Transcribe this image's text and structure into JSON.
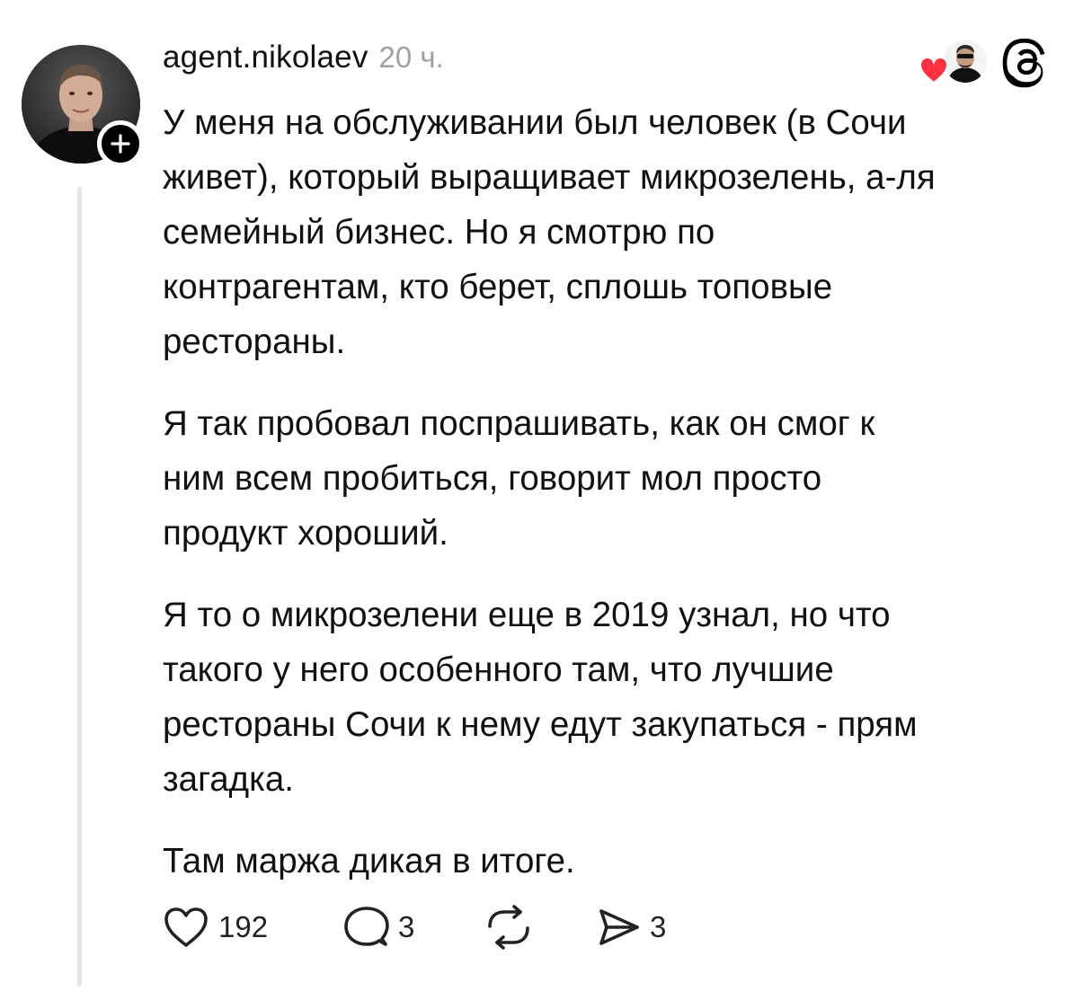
{
  "post": {
    "username": "agent.nikolaev",
    "timestamp": "20 ч.",
    "paragraphs": [
      "У меня на обслуживании был человек (в Сочи\nживет), который выращивает микрозелень, а-ля\nсемейный бизнес. Но я смотрю по\nконтрагентам, кто берет, сплошь топовые\nрестораны.",
      "Я так пробовал поспрашивать, как он смог к\nним всем пробиться, говорит мол просто\nпродукт хороший.",
      "Я то о микрозелени еще в 2019 узнал, но что\nтакого у него особенного там, что лучшие\nрестораны Сочи к нему едут закупаться - прям\nзагадка.",
      "Там маржа дикая в итоге."
    ],
    "actions": {
      "likes": "192",
      "replies": "3",
      "shares": "3"
    }
  },
  "icons": {
    "follow": "plus-icon",
    "liked_by": "heart-icon",
    "brand": "threads-logo-icon",
    "like": "heart-outline-icon",
    "reply": "speech-bubble-icon",
    "repost": "repost-icon",
    "share": "paper-plane-icon"
  },
  "colors": {
    "accent_heart": "#ff3040",
    "text": "#111111",
    "muted": "#a0a0a0",
    "thread_line": "#e6e6e6"
  }
}
